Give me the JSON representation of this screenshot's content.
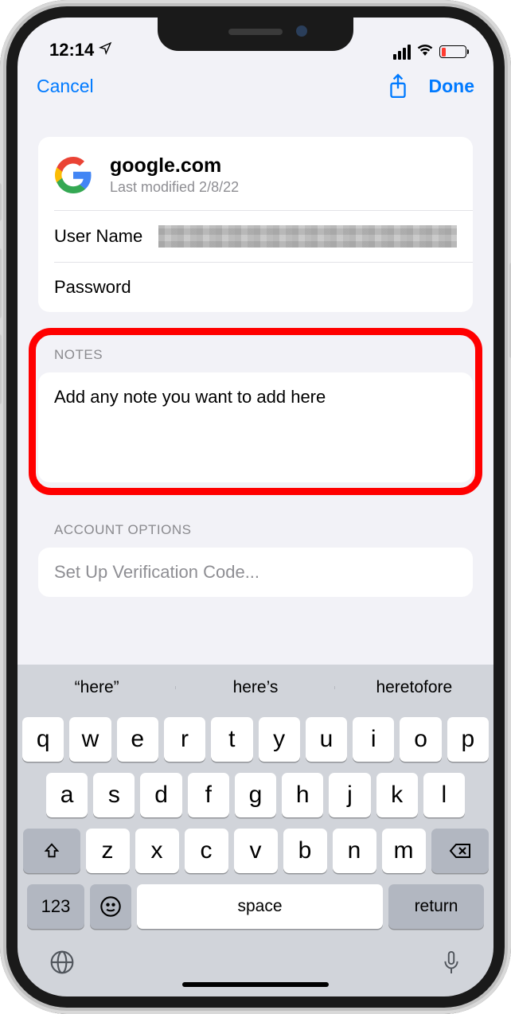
{
  "status": {
    "time": "12:14",
    "loc_arrow": "↗"
  },
  "nav": {
    "cancel": "Cancel",
    "done": "Done"
  },
  "service": {
    "title": "google.com",
    "subtitle": "Last modified 2/8/22"
  },
  "fields": {
    "username_label": "User Name",
    "password_label": "Password"
  },
  "notes": {
    "header": "NOTES",
    "text": "Add any note you want to add here"
  },
  "account_options": {
    "header": "ACCOUNT OPTIONS",
    "verification": "Set Up Verification Code..."
  },
  "keyboard": {
    "suggestions": [
      "“here”",
      "here’s",
      "heretofore"
    ],
    "row1": [
      "q",
      "w",
      "e",
      "r",
      "t",
      "y",
      "u",
      "i",
      "o",
      "p"
    ],
    "row2": [
      "a",
      "s",
      "d",
      "f",
      "g",
      "h",
      "j",
      "k",
      "l"
    ],
    "row3": [
      "z",
      "x",
      "c",
      "v",
      "b",
      "n",
      "m"
    ],
    "k123": "123",
    "space": "space",
    "return": "return"
  }
}
